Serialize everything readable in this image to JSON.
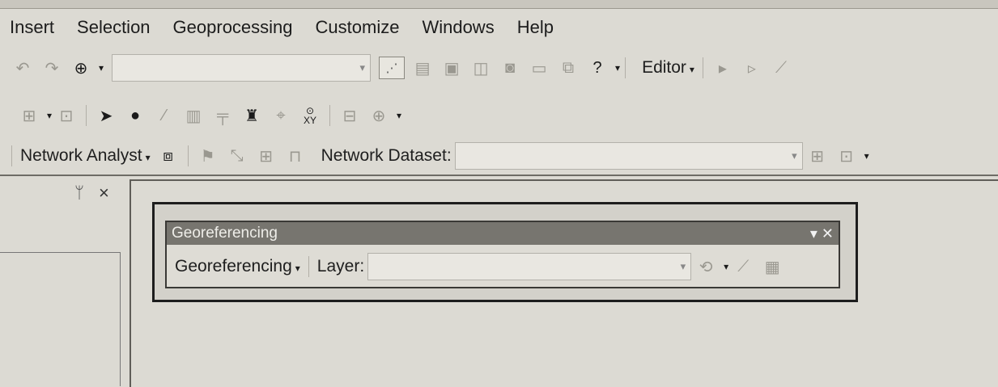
{
  "menubar": {
    "items": [
      "Insert",
      "Selection",
      "Geoprocessing",
      "Customize",
      "Windows",
      "Help"
    ]
  },
  "toolbar1": {
    "editor_label": "Editor"
  },
  "toolbar2": {
    "xy_label": "XY"
  },
  "network_toolbar": {
    "analyst_label": "Network Analyst",
    "dataset_label": "Network Dataset:",
    "dataset_value": ""
  },
  "left_panel": {
    "pin_glyph": "14",
    "close_glyph": "×"
  },
  "georef_toolbar": {
    "title": "Georeferencing",
    "dropdown_label": "Georeferencing",
    "layer_label": "Layer:",
    "layer_value": ""
  },
  "colors": {
    "background": "#dcdad3",
    "title_bar": "#77756f",
    "frame": "#1d1d1d"
  }
}
